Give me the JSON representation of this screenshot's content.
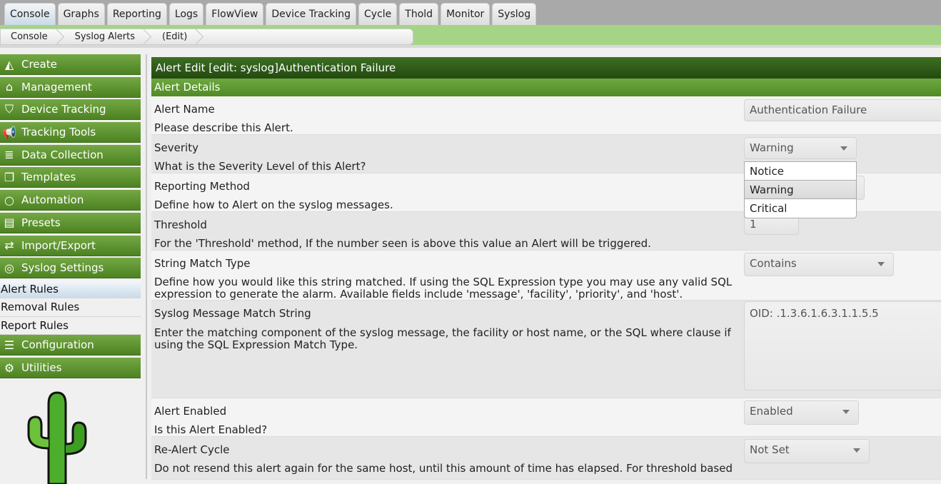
{
  "tabs": [
    "Console",
    "Graphs",
    "Reporting",
    "Logs",
    "FlowView",
    "Device Tracking",
    "Cycle",
    "Thold",
    "Monitor",
    "Syslog"
  ],
  "active_tab": "Console",
  "breadcrumb": [
    "Console",
    "Syslog Alerts",
    "(Edit)"
  ],
  "sidebar": {
    "menus_top": [
      {
        "label": "Create",
        "icon": "chart-area-icon"
      },
      {
        "label": "Management",
        "icon": "home-icon"
      },
      {
        "label": "Device Tracking",
        "icon": "shield-icon"
      },
      {
        "label": "Tracking Tools",
        "icon": "bullhorn-icon"
      },
      {
        "label": "Data Collection",
        "icon": "database-icon"
      },
      {
        "label": "Templates",
        "icon": "clone-icon"
      },
      {
        "label": "Automation",
        "icon": "circle-icon"
      },
      {
        "label": "Presets",
        "icon": "archive-icon"
      },
      {
        "label": "Import/Export",
        "icon": "exchange-icon"
      },
      {
        "label": "Syslog Settings",
        "icon": "life-ring-icon"
      }
    ],
    "subitems": [
      "Alert Rules",
      "Removal Rules",
      "Report Rules"
    ],
    "active_subitem": "Alert Rules",
    "menus_bottom": [
      {
        "label": "Configuration",
        "icon": "sliders-icon"
      },
      {
        "label": "Utilities",
        "icon": "cogs-icon"
      }
    ]
  },
  "main": {
    "title": "Alert Edit [edit: syslog]Authentication Failure",
    "section": "Alert Details",
    "fields": {
      "name": {
        "label": "Alert Name",
        "desc": "Please describe this Alert.",
        "value": "Authentication Failure"
      },
      "severity": {
        "label": "Severity",
        "desc": "What is the Severity Level of this Alert?",
        "value": "Warning",
        "options": [
          "Notice",
          "Warning",
          "Critical"
        ]
      },
      "method": {
        "label": "Reporting Method",
        "desc": "Define how to Alert on the syslog messages."
      },
      "threshold": {
        "label": "Threshold",
        "desc": "For the 'Threshold' method, If the number seen is above this value an Alert will be triggered.",
        "value": "1"
      },
      "match_type": {
        "label": "String Match Type",
        "desc": "Define how you would like this string matched. If using the SQL Expression type you may use any valid SQL expression to generate the alarm. Available fields include 'message', 'facility', 'priority', and 'host'.",
        "value": "Contains"
      },
      "match_string": {
        "label": "Syslog Message Match String",
        "desc": "Enter the matching component of the syslog message, the facility or host name, or the SQL where clause if using the SQL Expression Match Type.",
        "value": "OID: .1.3.6.1.6.3.1.1.5.5"
      },
      "enabled": {
        "label": "Alert Enabled",
        "desc": "Is this Alert Enabled?",
        "value": "Enabled"
      },
      "realert": {
        "label": "Re-Alert Cycle",
        "desc": "Do not resend this alert again for the same host, until this amount of time has elapsed. For threshold based",
        "value": "Not Set"
      }
    }
  }
}
